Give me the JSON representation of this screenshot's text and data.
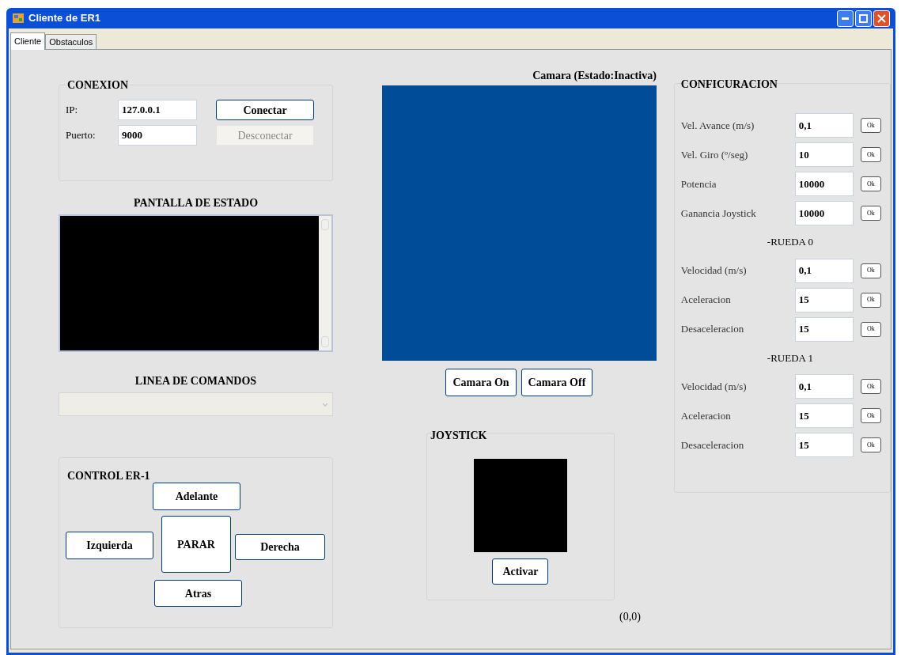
{
  "window": {
    "title": "Cliente de ER1"
  },
  "tabs": [
    {
      "label": "Cliente",
      "selected": true
    },
    {
      "label": "Obstaculos",
      "selected": false
    }
  ],
  "connection": {
    "title": "CONEXION",
    "fields": [
      {
        "label": "IP:",
        "value": "127.0.0.1"
      },
      {
        "label": "Puerto:",
        "value": "9000"
      }
    ],
    "buttons": [
      {
        "label": "Conectar",
        "disabled": false
      },
      {
        "label": "Desconectar",
        "disabled": true
      }
    ]
  },
  "status_screen": {
    "title": "PANTALLA DE ESTADO"
  },
  "command_line": {
    "title": "LINEA DE COMANDOS",
    "disabled": true
  },
  "control": {
    "title": "CONTROL ER-1",
    "buttons": [
      "Adelante",
      "Izquierda",
      "PARAR",
      "Derecha",
      "Atras"
    ]
  },
  "camera": {
    "status": "Camara (Estado:Inactiva)",
    "buttons": [
      "Camara On",
      "Camara Off"
    ]
  },
  "joystick": {
    "title": "JOYSTICK",
    "button": "Activar",
    "position": "(0,0)"
  },
  "configuration": {
    "title": "CONFICURACION",
    "items": [
      {
        "kind": "field",
        "label": "Vel. Avance (m/s)",
        "value": "0,1",
        "button": "Ok"
      },
      {
        "kind": "field",
        "label": "Vel. Giro (º/seg)",
        "value": "10",
        "button": "Ok"
      },
      {
        "kind": "field",
        "label": "Potencia",
        "value": "10000",
        "button": "Ok"
      },
      {
        "kind": "field",
        "label": "Ganancia Joystick",
        "value": "10000",
        "button": "Ok"
      },
      {
        "kind": "heading",
        "label": "-RUEDA 0"
      },
      {
        "kind": "field",
        "label": "Velocidad (m/s)",
        "value": "0,1",
        "button": "Ok"
      },
      {
        "kind": "field",
        "label": "Aceleracion",
        "value": "15",
        "button": "Ok"
      },
      {
        "kind": "field",
        "label": "Desaceleracion",
        "value": "15",
        "button": "Ok"
      },
      {
        "kind": "heading",
        "label": "-RUEDA 1"
      },
      {
        "kind": "field",
        "label": "Velocidad (m/s)",
        "value": "0,1",
        "button": "Ok"
      },
      {
        "kind": "field",
        "label": "Aceleracion",
        "value": "15",
        "button": "Ok"
      },
      {
        "kind": "field",
        "label": "Desaceleracion",
        "value": "15",
        "button": "Ok"
      }
    ]
  }
}
